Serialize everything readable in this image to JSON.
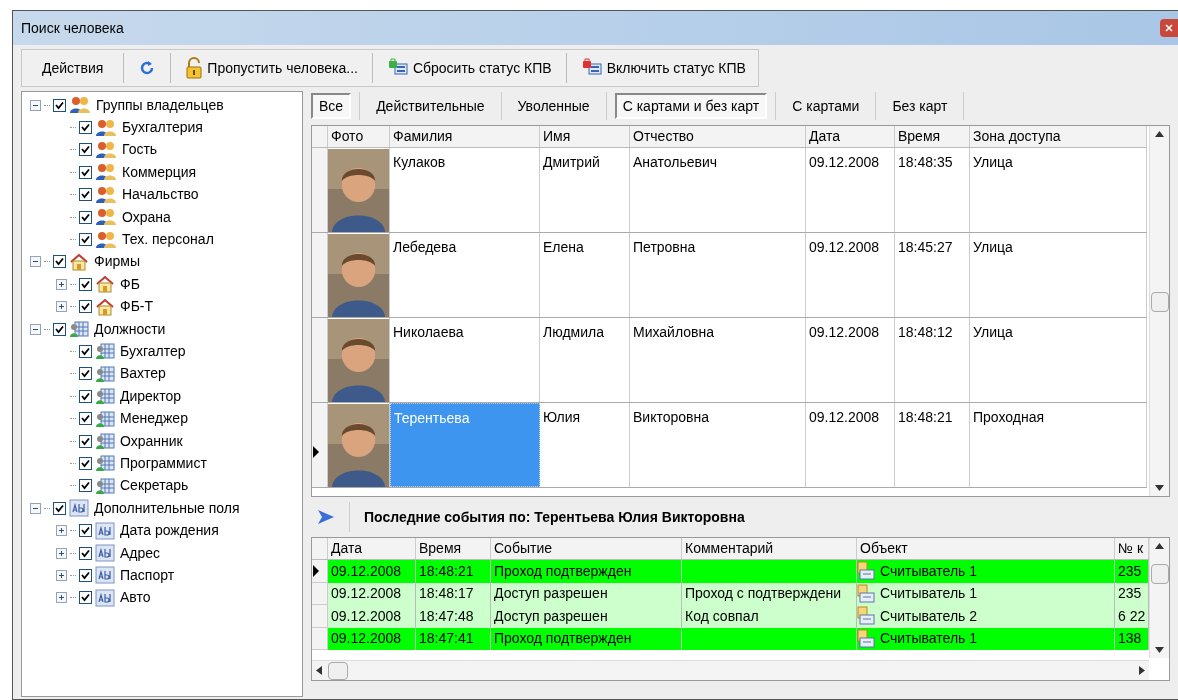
{
  "window": {
    "title": "Поиск человека"
  },
  "toolbar": {
    "menu": "Действия",
    "buttons": [
      {
        "kind": "refresh"
      },
      {
        "kind": "unlock",
        "label": "Пропустить человека..."
      },
      {
        "kind": "reset",
        "label": "Сбросить статус КПВ"
      },
      {
        "kind": "enable",
        "label": "Включить статус КПВ"
      }
    ]
  },
  "tree": [
    {
      "label": "Группы владельцев",
      "kind": "group",
      "checked": true,
      "expanded": true,
      "children": [
        {
          "label": "Бухгалтерия",
          "kind": "group",
          "checked": true
        },
        {
          "label": "Гость",
          "kind": "group",
          "checked": true
        },
        {
          "label": "Коммерция",
          "kind": "group",
          "checked": true
        },
        {
          "label": "Начальство",
          "kind": "group",
          "checked": true
        },
        {
          "label": "Охрана",
          "kind": "group",
          "checked": true
        },
        {
          "label": "Тех. персонал",
          "kind": "group",
          "checked": true
        }
      ]
    },
    {
      "label": "Фирмы",
      "kind": "firm",
      "checked": true,
      "expanded": true,
      "children": [
        {
          "label": "ФБ",
          "kind": "firm",
          "checked": true,
          "expanded": false
        },
        {
          "label": "ФБ-Т",
          "kind": "firm",
          "checked": true,
          "expanded": false
        }
      ]
    },
    {
      "label": "Должности",
      "kind": "position",
      "checked": true,
      "expanded": true,
      "children": [
        {
          "label": "Бухгалтер",
          "kind": "position",
          "checked": true
        },
        {
          "label": "Вахтер",
          "kind": "position",
          "checked": true
        },
        {
          "label": "Директор",
          "kind": "position",
          "checked": true
        },
        {
          "label": "Менеджер",
          "kind": "position",
          "checked": true
        },
        {
          "label": "Охранник",
          "kind": "position",
          "checked": true
        },
        {
          "label": "Программист",
          "kind": "position",
          "checked": true
        },
        {
          "label": "Секретарь",
          "kind": "position",
          "checked": true
        }
      ]
    },
    {
      "label": "Дополнительные поля",
      "kind": "field",
      "checked": true,
      "expanded": true,
      "children": [
        {
          "label": "Дата рождения",
          "kind": "field",
          "checked": true,
          "expanded": false
        },
        {
          "label": "Адрес",
          "kind": "field",
          "checked": true,
          "expanded": false
        },
        {
          "label": "Паспорт",
          "kind": "field",
          "checked": true,
          "expanded": false
        },
        {
          "label": "Авто",
          "kind": "field",
          "checked": true,
          "expanded": false
        }
      ]
    }
  ],
  "filters": [
    {
      "label": "Все",
      "selected": true
    },
    {
      "label": "Действительные",
      "selected": false
    },
    {
      "label": "Уволенные",
      "selected": false
    },
    {
      "label": "С картами и без карт",
      "selected": true
    },
    {
      "label": "С картами",
      "selected": false
    },
    {
      "label": "Без карт",
      "selected": false
    }
  ],
  "people": {
    "columns": [
      "Фото",
      "Фамилия",
      "Имя",
      "Отчество",
      "Дата",
      "Время",
      "Зона доступа"
    ],
    "rows": [
      {
        "cells": [
          {
            "kind": "picture"
          },
          "Кулаков",
          "Дмитрий",
          "Анатольевич",
          "09.12.2008",
          "18:48:35",
          "Улица"
        ],
        "selected": false
      },
      {
        "cells": [
          {
            "kind": "picture"
          },
          "Лебедева",
          "Елена",
          "Петровна",
          "09.12.2008",
          "18:45:27",
          "Улица"
        ],
        "selected": false
      },
      {
        "cells": [
          {
            "kind": "picture"
          },
          "Николаева",
          "Людмила",
          "Михайловна",
          "09.12.2008",
          "18:48:12",
          "Улица"
        ],
        "selected": false
      },
      {
        "cells": [
          {
            "kind": "picture"
          },
          "Терентьева",
          "Юлия",
          "Викторовна",
          "09.12.2008",
          "18:48:21",
          "Проходная"
        ],
        "selected": true
      }
    ]
  },
  "events": {
    "title": "Последние события по: Терентьева Юлия Викторовна",
    "columns": [
      "Дата",
      "Время",
      "Событие",
      "Комментарий",
      "Объект",
      "№ к"
    ],
    "rows": [
      {
        "cells": [
          "09.12.2008",
          "18:48:21",
          "Проход подтвержден",
          "",
          "Считыватель 1",
          "235"
        ],
        "color": "#00ff00",
        "selected": true
      },
      {
        "cells": [
          "09.12.2008",
          "18:48:17",
          "Доступ разрешен",
          "Проход с подтверждени",
          "Считыватель 1",
          "235"
        ],
        "color": "#ccffcc",
        "selected": false
      },
      {
        "cells": [
          "09.12.2008",
          "18:47:48",
          "Доступ разрешен",
          "Код совпал",
          "Считыватель 2",
          "6 22"
        ],
        "color": "#ccffcc",
        "selected": false
      },
      {
        "cells": [
          "09.12.2008",
          "18:47:41",
          "Проход подтвержден",
          "",
          "Считыватель 1",
          "138"
        ],
        "color": "#00ff00",
        "selected": false
      }
    ]
  }
}
